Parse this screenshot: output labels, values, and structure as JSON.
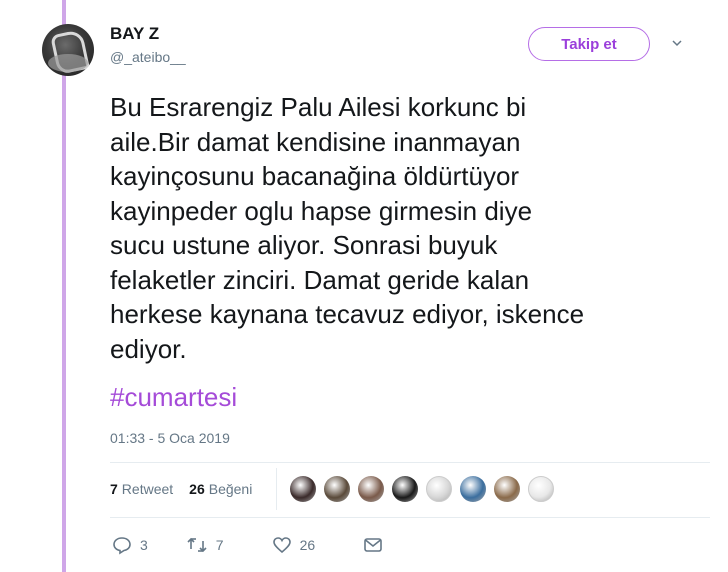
{
  "user": {
    "name": "BAY Z",
    "handle": "@_ateibo__"
  },
  "follow_button": {
    "label": "Takip et"
  },
  "tweet": {
    "lines": [
      "Bu Esrarengiz Palu Ailesi korkunc bi",
      "aile.Bir damat kendisine inanmayan",
      "kayinçosunu bacanağina öldürtüyor",
      "kayinpeder oglu hapse girmesin diye",
      "sucu ustune aliyor. Sonrasi buyuk",
      "felaketler zinciri. Damat geride kalan",
      "herkese kaynana tecavuz ediyor, iskence",
      "ediyor."
    ],
    "hashtag": "#cumartesi",
    "timestamp": "01:33 - 5 Oca 2019"
  },
  "stats": {
    "retweet_count": "7",
    "retweet_label": "Retweet",
    "like_count": "26",
    "like_label": "Beğeni"
  },
  "liker_avatars": [
    {
      "name": "liker-1",
      "color": "#3a2a2a"
    },
    {
      "name": "liker-2",
      "color": "#5a4a3a"
    },
    {
      "name": "liker-3",
      "color": "#7a5a4a"
    },
    {
      "name": "liker-4",
      "color": "#1a1a1a"
    },
    {
      "name": "liker-5",
      "color": "#d8d8d8"
    },
    {
      "name": "liker-6",
      "color": "#3b6e9e"
    },
    {
      "name": "liker-7",
      "color": "#8a6a4a"
    },
    {
      "name": "liker-8",
      "color": "#e8e8e8"
    }
  ],
  "actions": {
    "reply_count": "3",
    "retweet_count": "7",
    "like_count": "26"
  },
  "colors": {
    "accent": "#a54bd8",
    "thread_line": "#cfa6e8",
    "muted": "#657786"
  }
}
